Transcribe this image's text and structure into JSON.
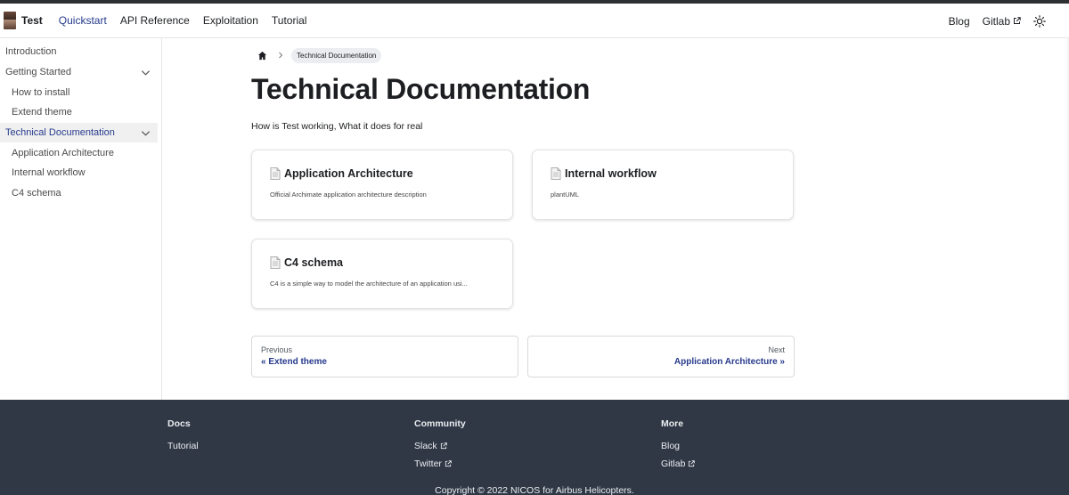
{
  "navbar": {
    "brand": "Test",
    "links": [
      "Quickstart",
      "API Reference",
      "Exploitation",
      "Tutorial"
    ],
    "right_links": [
      "Blog",
      "Gitlab"
    ]
  },
  "sidebar": {
    "items": [
      {
        "label": "Introduction"
      },
      {
        "label": "Getting Started"
      },
      {
        "label": "How to install"
      },
      {
        "label": "Extend theme"
      },
      {
        "label": "Technical Documentation"
      },
      {
        "label": "Application Architecture"
      },
      {
        "label": "Internal workflow"
      },
      {
        "label": "C4 schema"
      }
    ]
  },
  "breadcrumb": {
    "current": "Technical Documentation"
  },
  "main": {
    "title": "Technical Documentation",
    "description": "How is Test working, What it does for real"
  },
  "cards": [
    {
      "title": "Application Architecture",
      "description": "Official Archimate application architecture description"
    },
    {
      "title": "Internal workflow",
      "description": "plantUML"
    },
    {
      "title": "C4 schema",
      "description": "C4 is a simple way to model the architecture of an application usi..."
    }
  ],
  "pager": {
    "prev_sub": "Previous",
    "prev_label": "« Extend theme",
    "next_sub": "Next",
    "next_label": "Application Architecture »"
  },
  "footer": {
    "columns": [
      {
        "title": "Docs",
        "links": [
          "Tutorial"
        ]
      },
      {
        "title": "Community",
        "links": [
          "Slack",
          "Twitter"
        ]
      },
      {
        "title": "More",
        "links": [
          "Blog",
          "Gitlab"
        ]
      }
    ],
    "copyright": "Copyright © 2022 NICOS for Airbus Helicopters."
  },
  "colors": {
    "accent": "#263a8c",
    "footer_bg": "#303846",
    "active_bg": "#f0f0f0"
  }
}
